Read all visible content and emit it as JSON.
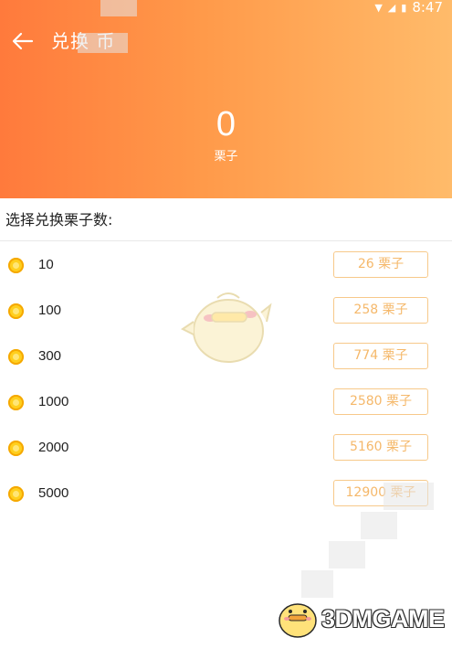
{
  "status_bar": {
    "time": "8:47"
  },
  "header": {
    "title": "兑换 币",
    "balance_value": "0",
    "balance_unit": "栗子"
  },
  "section_label": "选择兑换栗子数:",
  "options": [
    {
      "amount": "10",
      "price": "26 栗子"
    },
    {
      "amount": "100",
      "price": "258 栗子"
    },
    {
      "amount": "300",
      "price": "774 栗子"
    },
    {
      "amount": "1000",
      "price": "2580 栗子"
    },
    {
      "amount": "2000",
      "price": "5160 栗子"
    },
    {
      "amount": "5000",
      "price": "12900 栗子"
    }
  ],
  "watermark": {
    "text": "3DMGAME"
  },
  "colors": {
    "header_start": "#ff7a3c",
    "header_end": "#ffbb6a",
    "coin": "#ffcf1e",
    "button_border": "#f7c98a",
    "button_text": "#f5b86a"
  }
}
